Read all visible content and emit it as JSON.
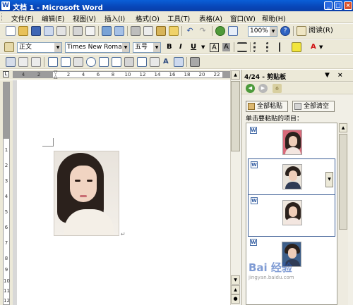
{
  "window": {
    "title": "文档 1 - Microsoft Word"
  },
  "menu": [
    "文件(F)",
    "编辑(E)",
    "视图(V)",
    "插入(I)",
    "格式(O)",
    "工具(T)",
    "表格(A)",
    "窗口(W)",
    "帮助(H)"
  ],
  "toolbar": {
    "zoom": "100%",
    "read_label": "阅读(R)",
    "style_value": "正文",
    "font_value": "Times New Roman",
    "size_value": "五号",
    "bold": "B",
    "italic": "I",
    "underline": "U",
    "char_border": "A",
    "char_shading": "A"
  },
  "ruler": {
    "ticks": [
      "4",
      "2",
      "2",
      "4",
      "6",
      "8",
      "10",
      "12",
      "14",
      "16",
      "18",
      "20",
      "22"
    ],
    "vticks": [
      "1",
      "2",
      "3",
      "4",
      "5",
      "6",
      "7",
      "8",
      "9",
      "10",
      "11",
      "12"
    ]
  },
  "clipboard_pane": {
    "title": "4/24 - 剪贴板",
    "paste_all": "全部粘贴",
    "clear_all": "全部清空",
    "hint": "单击要粘贴的项目："
  },
  "clip_items": [
    {
      "subject": "woman",
      "tone": "#d86a7a"
    },
    {
      "subject": "man",
      "tone": "#e9e3da"
    },
    {
      "subject": "woman",
      "tone": "#f0e8df"
    },
    {
      "subject": "man",
      "tone": "#3d5f8a"
    }
  ],
  "watermark": {
    "logo": "Bai 经验",
    "url": "jingyan.baidu.com"
  }
}
